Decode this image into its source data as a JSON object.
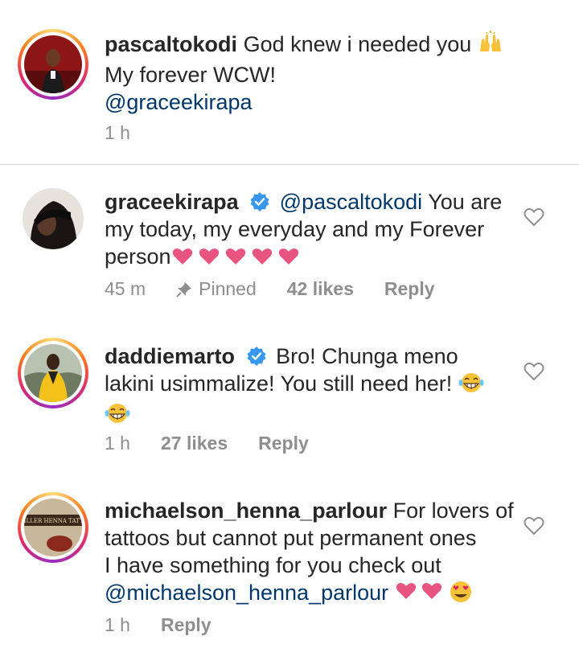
{
  "caption": {
    "username": "pascaltokodi",
    "line1": "God knew i needed you",
    "line2": "My forever WCW!",
    "mention": "@graceekirapa",
    "time": "1 h"
  },
  "comments": [
    {
      "username": "graceekirapa",
      "verified": true,
      "mention": "@pascaltokodi",
      "line1": "You are",
      "line2": "my today, my everyday and my Forever",
      "line3": "person",
      "time": "45 m",
      "pinned_label": "Pinned",
      "likes": "42 likes",
      "reply": "Reply"
    },
    {
      "username": "daddiemarto",
      "verified": true,
      "line1": "Bro! Chunga meno",
      "line2": "lakini usimmalize! You still need her!",
      "time": "1 h",
      "likes": "27 likes",
      "reply": "Reply"
    },
    {
      "username": "michaelson_henna_parlour",
      "line1": "For lovers of",
      "line2": "tattoos but cannot put permanent ones",
      "line3": "I have something for you check out",
      "mention": "@michaelson_henna_parlour",
      "time": "1 h",
      "reply": "Reply",
      "avatar_text": "MILLER HENNA TATTO"
    }
  ],
  "colors": {
    "text": "#262626",
    "secondary": "#8e8e8e",
    "mention": "#00376b",
    "verified": "#3897f0",
    "emoji_heart": "#e75480",
    "divider": "#dbdbdb"
  }
}
